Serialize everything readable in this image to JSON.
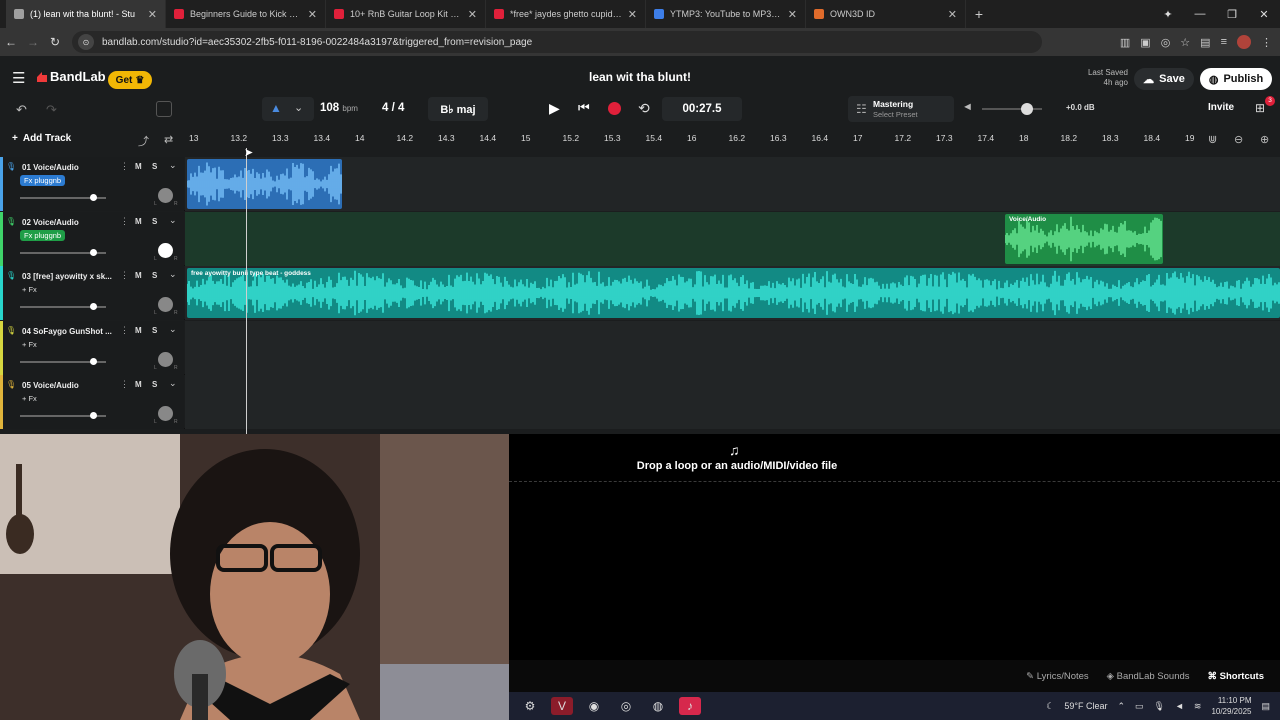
{
  "browser": {
    "tabs": [
      {
        "title": "(1) lean wit tha blunt! - Stu",
        "active": true,
        "color": "#a0a0a0"
      },
      {
        "title": "Beginners Guide to Kick Stream",
        "active": false,
        "color": "#e0203a"
      },
      {
        "title": "10+ RnB Guitar Loop Kit / Samp",
        "active": false,
        "color": "#e0203a"
      },
      {
        "title": "*free* jaydes ghetto cupid type",
        "active": false,
        "color": "#e0203a"
      },
      {
        "title": "YTMP3: YouTube to MP3 Conve",
        "active": false,
        "color": "#3d7ee8"
      },
      {
        "title": "OWN3D ID",
        "active": false,
        "color": "#e06b2b"
      }
    ],
    "url": "bandlab.com/studio?id=aec35302-2fb5-f011-8196-0022484a3197&triggered_from=revision_page"
  },
  "header": {
    "brand": "BandLab",
    "get_label": "Get",
    "project_title": "lean wit tha blunt!",
    "last_saved_label": "Last Saved",
    "last_saved_time": "4h ago",
    "save_label": "Save",
    "publish_label": "Publish"
  },
  "toolbar": {
    "bpm_value": "108",
    "bpm_unit": "bpm",
    "time_signature": "4 / 4",
    "key": "B♭ maj",
    "time": "00:27.5",
    "mastering_label": "Mastering",
    "select_preset": "Select Preset",
    "volume_db": "+0.0 dB",
    "volume_level": 0.75,
    "invite_label": "Invite",
    "notif_count": "3"
  },
  "timeline": {
    "add_track_label": "Add Track",
    "ticks": [
      "13",
      "13.2",
      "13.3",
      "13.4",
      "14",
      "14.2",
      "14.3",
      "14.4",
      "15",
      "15.2",
      "15.3",
      "15.4",
      "16",
      "16.2",
      "16.3",
      "16.4",
      "17",
      "17.2",
      "17.3",
      "17.4",
      "18",
      "18.2",
      "18.3",
      "18.4",
      "19"
    ]
  },
  "tracks": [
    {
      "num": "01",
      "name": "Voice/Audio",
      "fx": "Fx pluggnb",
      "color": "#4aa3ea",
      "fx_bg": "#2c7bd1",
      "volume": 0.85
    },
    {
      "num": "02",
      "name": "Voice/Audio",
      "fx": "Fx pluggnb",
      "color": "#3fd46a",
      "fx_bg": "#1f9e47",
      "volume": 0.85
    },
    {
      "num": "03",
      "name": "[free] ayowitty x sk...",
      "fx": "+ Fx",
      "color": "#29d6cc",
      "fx_bg": "transparent",
      "volume": 0.85
    },
    {
      "num": "04",
      "name": "SoFaygo GunShot ...",
      "fx": "+ Fx",
      "color": "#d6d640",
      "fx_bg": "transparent",
      "volume": 0.85
    },
    {
      "num": "05",
      "name": "Voice/Audio",
      "fx": "+ Fx",
      "color": "#e0b43b",
      "fx_bg": "transparent",
      "volume": 0.85
    }
  ],
  "clips": {
    "track2_label": "Voice/Audio",
    "track3_label": "free ayowitty  bunii type beat - goddess"
  },
  "mute_label": "M",
  "solo_label": "S",
  "dropzone": {
    "text": "Drop a loop or an audio/MIDI/video file"
  },
  "footer": {
    "lyrics": "Lyrics/Notes",
    "sounds": "BandLab Sounds",
    "shortcuts": "Shortcuts"
  },
  "taskbar": {
    "weather": "59°F  Clear",
    "time": "11:10 PM",
    "date": "10/29/2025"
  }
}
